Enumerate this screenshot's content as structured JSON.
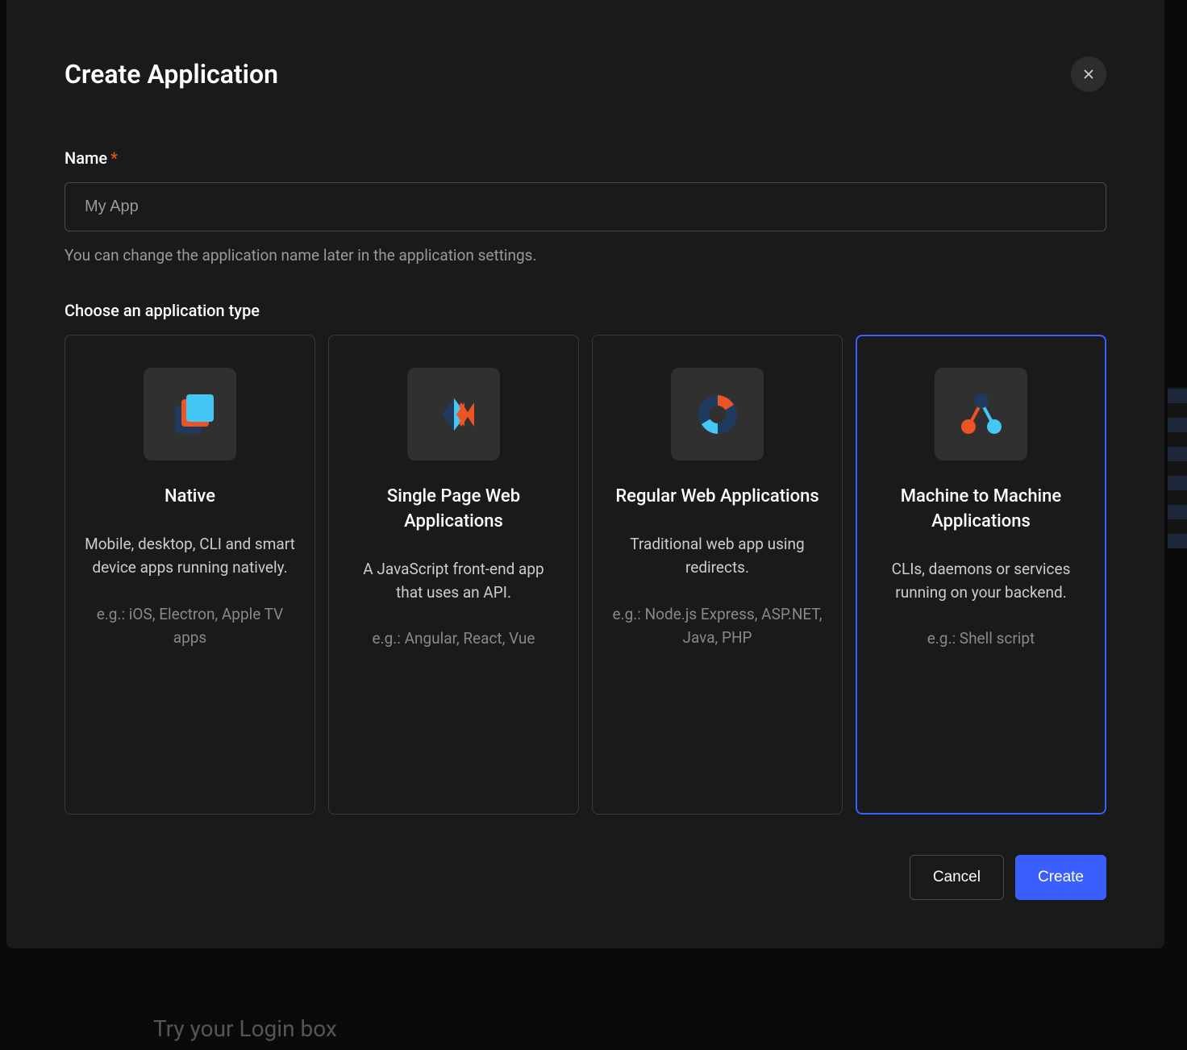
{
  "modal": {
    "title": "Create Application",
    "name_label": "Name",
    "required_marker": "*",
    "name_placeholder": "My App",
    "name_value": "",
    "name_hint": "You can change the application name later in the application settings.",
    "type_label": "Choose an application type"
  },
  "types": [
    {
      "title": "Native",
      "description": "Mobile, desktop, CLI and smart device apps running natively.",
      "example": "e.g.: iOS, Electron, Apple TV apps",
      "selected": false,
      "icon": "native"
    },
    {
      "title": "Single Page Web Applications",
      "description": "A JavaScript front-end app that uses an API.",
      "example": "e.g.: Angular, React, Vue",
      "selected": false,
      "icon": "spa"
    },
    {
      "title": "Regular Web Applications",
      "description": "Traditional web app using redirects.",
      "example": "e.g.: Node.js Express, ASP.NET, Java, PHP",
      "selected": false,
      "icon": "webapp"
    },
    {
      "title": "Machine to Machine Applications",
      "description": "CLIs, daemons or services running on your backend.",
      "example": "e.g.: Shell script",
      "selected": true,
      "icon": "m2m"
    }
  ],
  "footer": {
    "cancel": "Cancel",
    "create": "Create"
  },
  "background": {
    "login_text": "Try your Login box"
  }
}
